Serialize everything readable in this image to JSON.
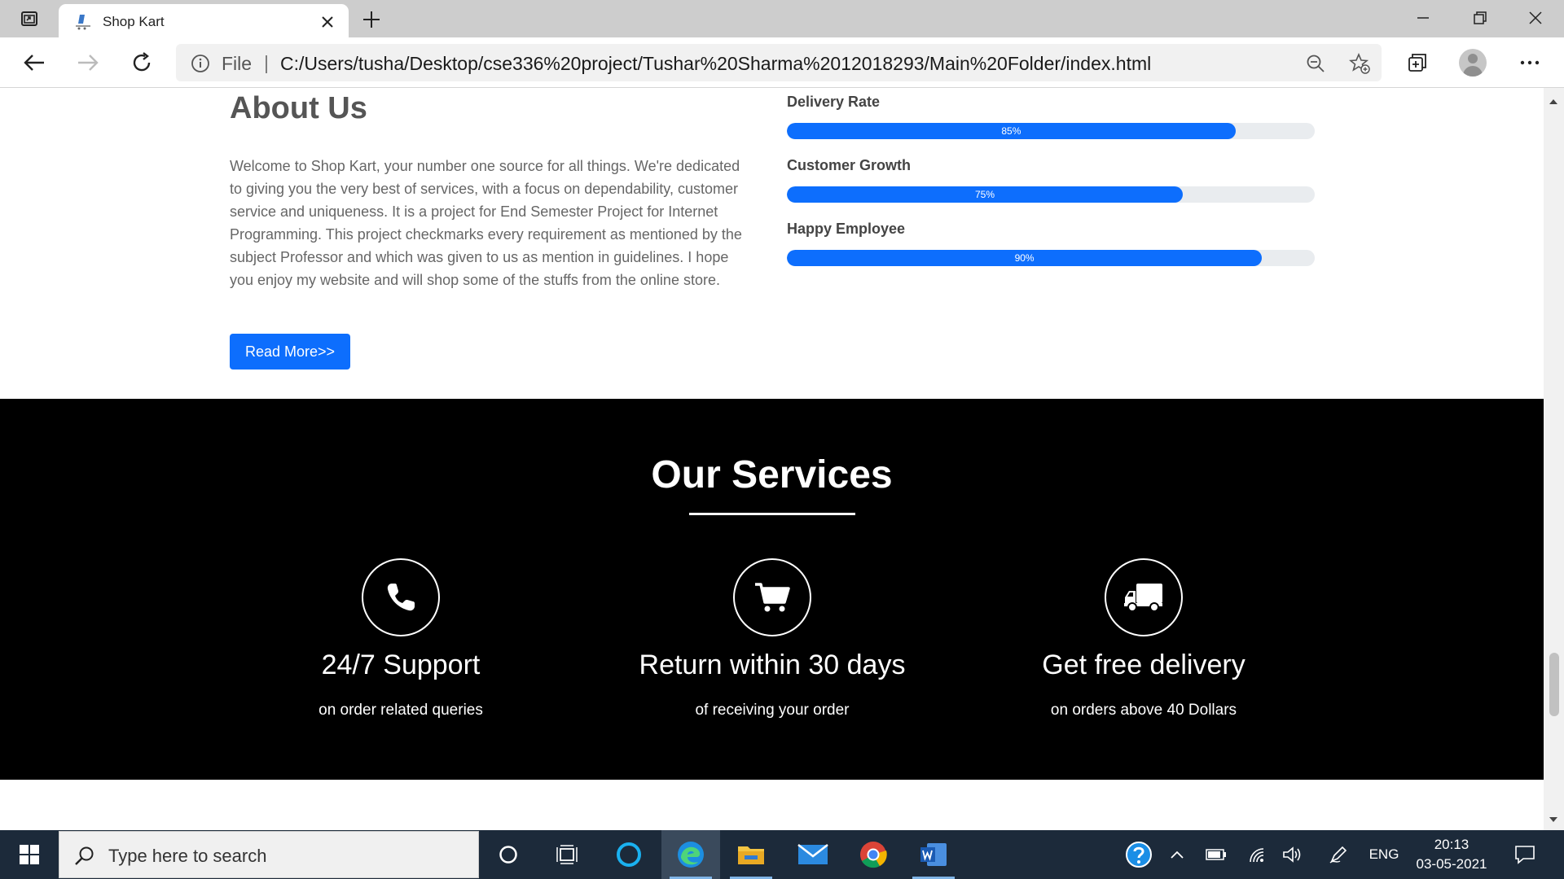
{
  "browser": {
    "tab_title": "Shop Kart",
    "address_scheme": "File",
    "address_separator": "|",
    "url": "C:/Users/tusha/Desktop/cse336%20project/Tushar%20Sharma%2012018293/Main%20Folder/index.html"
  },
  "about": {
    "title": "About Us",
    "text": "Welcome to Shop Kart, your number one source for all things. We're dedicated to giving you the very best of services, with a focus on dependability, customer service and uniqueness. It is a project for End Semester Project for Internet Programming. This project checkmarks every requirement as mentioned by the subject Professor and which was given to us as mention in guidelines. I hope you enjoy my website and will shop some of the stuffs from the online store.",
    "button_label": "Read More>>"
  },
  "skills": [
    {
      "label": "Delivery Rate",
      "value_text": "85%",
      "value": 85
    },
    {
      "label": "Customer Growth",
      "value_text": "75%",
      "value": 75
    },
    {
      "label": "Happy Employee",
      "value_text": "90%",
      "value": 90
    }
  ],
  "services": {
    "title": "Our Services",
    "items": [
      {
        "icon": "phone-icon",
        "title": "24/7 Support",
        "subtitle": "on order related queries"
      },
      {
        "icon": "cart-icon",
        "title": "Return within 30 days",
        "subtitle": "of receiving your order"
      },
      {
        "icon": "truck-icon",
        "title": "Get free delivery",
        "subtitle": "on orders above 40 Dollars"
      }
    ]
  },
  "taskbar": {
    "search_placeholder": "Type here to search",
    "language": "ENG",
    "time": "20:13",
    "date": "03-05-2021"
  },
  "colors": {
    "accent": "#0d6efd",
    "services_bg": "#000000",
    "taskbar_bg": "#1c2a3a"
  }
}
